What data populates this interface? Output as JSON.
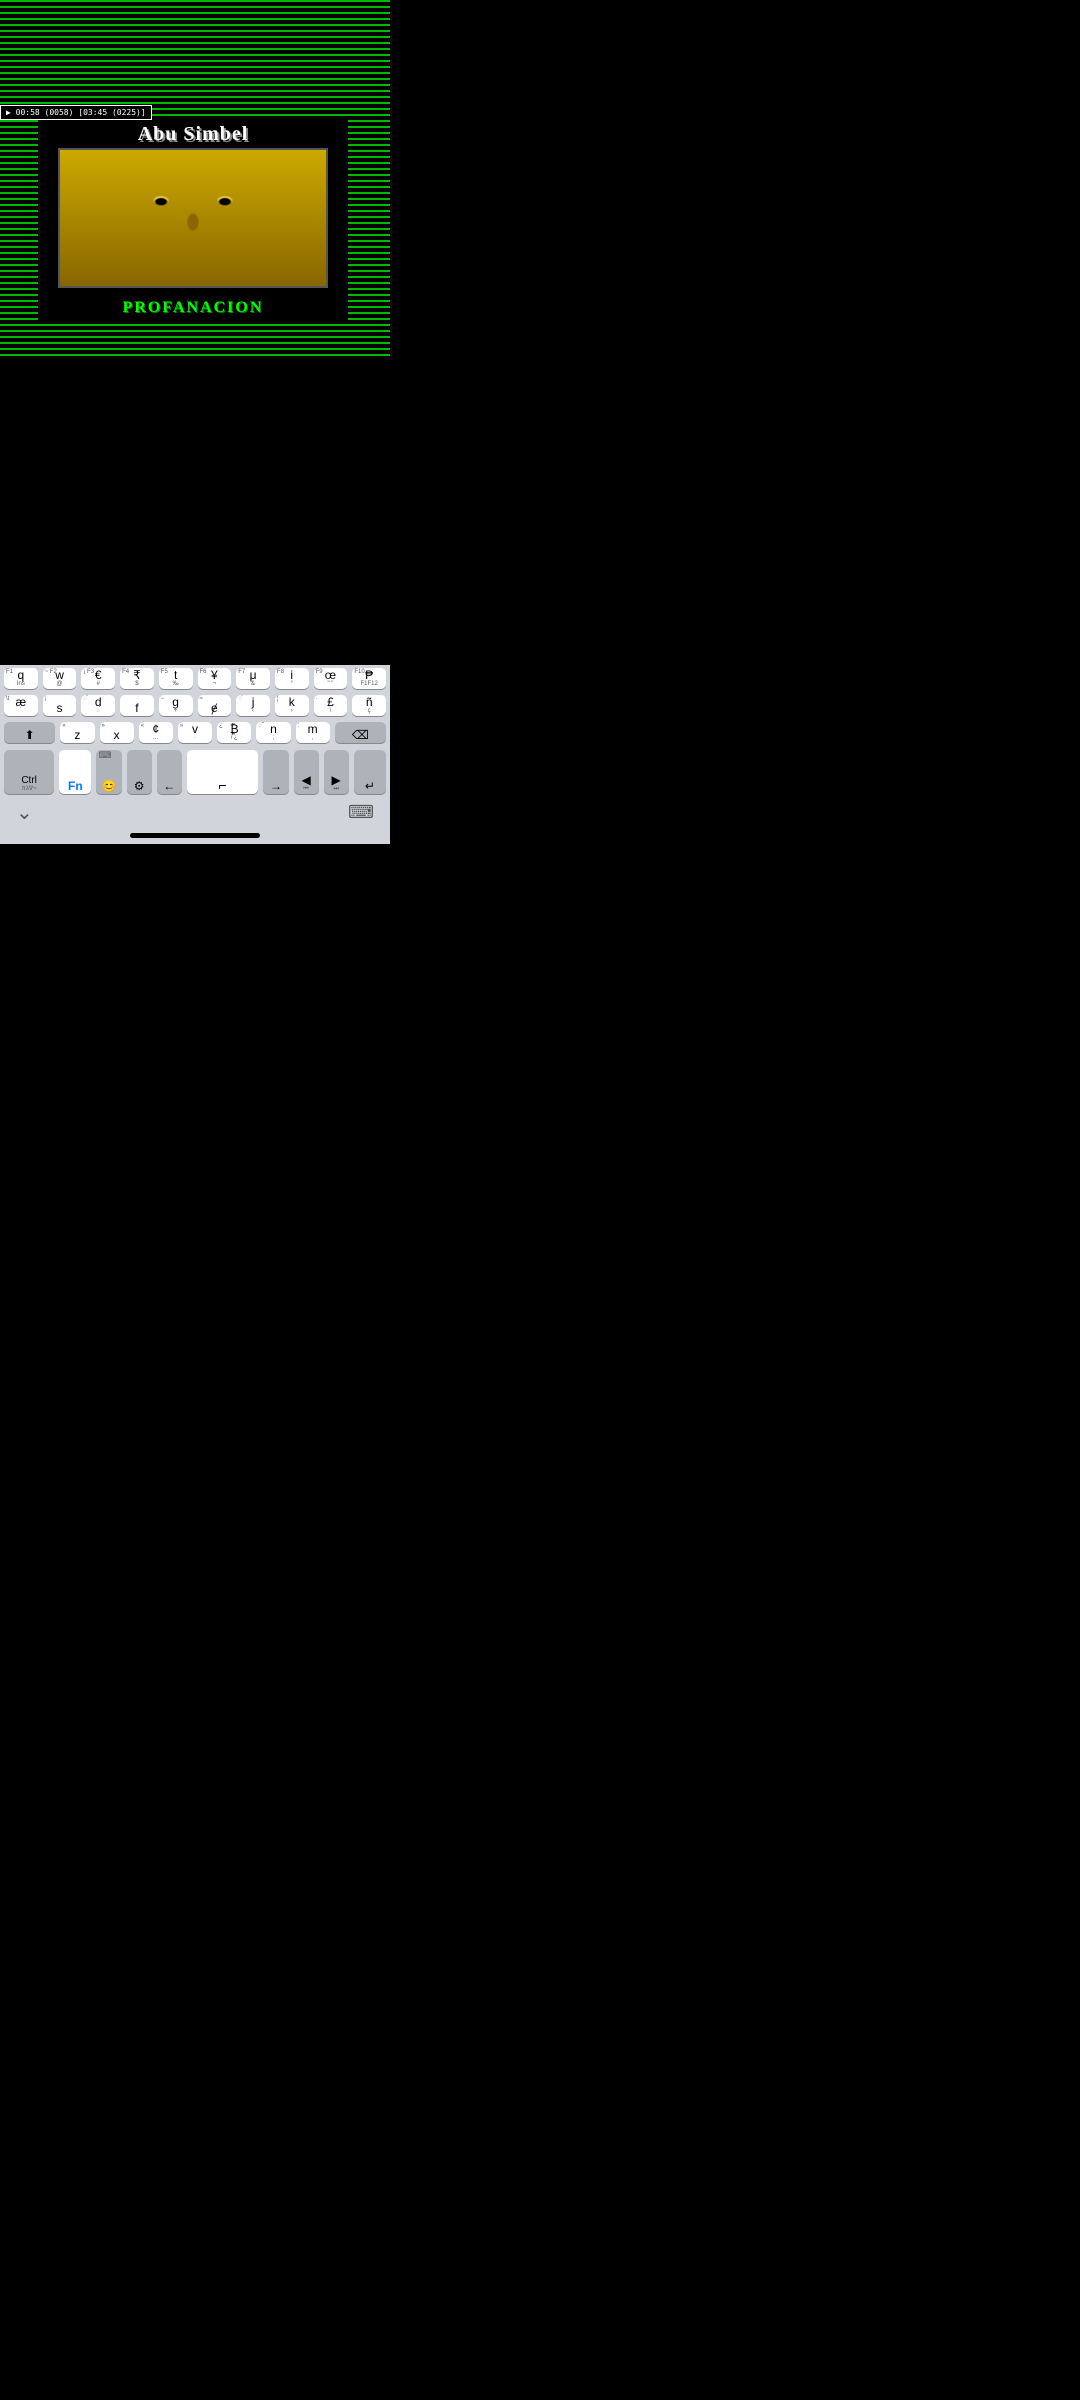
{
  "emulator": {
    "status_bar": "▶ 00:58 (0058) [03:45 (0225)]",
    "game_title": "Abu Simbel",
    "game_subtitle": "ProfanacioN"
  },
  "keyboard": {
    "rows": [
      [
        {
          "top": "F1",
          "main": "q",
          "bot": "Ins"
        },
        {
          "top": "~ F2",
          "main": "w",
          "bot": "@"
        },
        {
          "top": "¡ F3",
          "main": "€",
          "bot": "#"
        },
        {
          "top": "F4",
          "main": "₹",
          "bot": "$"
        },
        {
          "top": "F5",
          "main": "t",
          "bot": "‰"
        },
        {
          "top": "F6",
          "main": "¥",
          "bot": "¬"
        },
        {
          "top": "F7",
          "main": "μ",
          "bot": "&"
        },
        {
          "top": "F8",
          "main": "i",
          "bot": "°"
        },
        {
          "top": "F9",
          "main": "œ",
          "bot": "\" \""
        },
        {
          "top": "F10",
          "main": "₱",
          "bot": "F1F12"
        }
      ],
      [
        {
          "top": "\\t",
          "main": "æ",
          "bot": "`"
        },
        {
          "top": "¡",
          "main": "s",
          "bot": ""
        },
        {
          "top": "◌̊",
          "main": "d",
          "bot": "◌́"
        },
        {
          "top": "",
          "main": "f",
          "bot": ""
        },
        {
          "top": "−",
          "main": "g",
          "bot": "+"
        },
        {
          "top": "≈",
          "main": "ɇ",
          "bot": ""
        },
        {
          "top": "◌̈",
          "main": "j",
          "bot": "‹"
        },
        {
          "top": "¦",
          "main": "k",
          "bot": "›"
        },
        {
          "top": "·",
          "main": "£",
          "bot": "\\"
        },
        {
          "top": "",
          "main": "ñ",
          "bot": "ç"
        }
      ],
      [
        {
          "top": "shift",
          "main": "⬆",
          "bot": "",
          "wide": true,
          "dark": true
        },
        {
          "top": "",
          "main": "z",
          "bot": ""
        },
        {
          "top": "",
          "main": "x",
          "bot": ""
        },
        {
          "top": "«",
          "main": "¢",
          "bot": "…"
        },
        {
          "top": "»",
          "main": "v",
          "bot": "·"
        },
        {
          "top": "¿",
          "main": "₿",
          "bot": "/ ¿"
        },
        {
          "top": "◌̃",
          "main": "n",
          "bot": ";"
        },
        {
          "top": ":",
          "main": "m",
          "bot": ","
        },
        {
          "top": "",
          "main": "⌫",
          "bot": "",
          "wide": true,
          "dark": true
        }
      ],
      [
        {
          "type": "ctrl",
          "main": "Ctrl",
          "sub": "πλ∇¬",
          "dark": true
        },
        {
          "type": "fn",
          "main": "Fn",
          "sub": "",
          "blue": true
        },
        {
          "type": "emoji",
          "main": "😊",
          "sub": "",
          "dark": true
        },
        {
          "type": "settings",
          "main": "⚙",
          "sub": "",
          "dark": true
        },
        {
          "type": "arrow-left",
          "main": "←",
          "dark": true
        },
        {
          "type": "space",
          "main": "⌐",
          "dark": false
        },
        {
          "type": "arrow-right",
          "main": "→",
          "dark": true
        },
        {
          "type": "nav-left",
          "main": "◀",
          "dark": true
        },
        {
          "type": "nav-right",
          "main": "▶",
          "dark": true
        },
        {
          "type": "enter",
          "main": "↵",
          "dark": true
        }
      ]
    ],
    "bottom": {
      "hide_label": "⌄",
      "keyboard_label": "⌨"
    }
  }
}
